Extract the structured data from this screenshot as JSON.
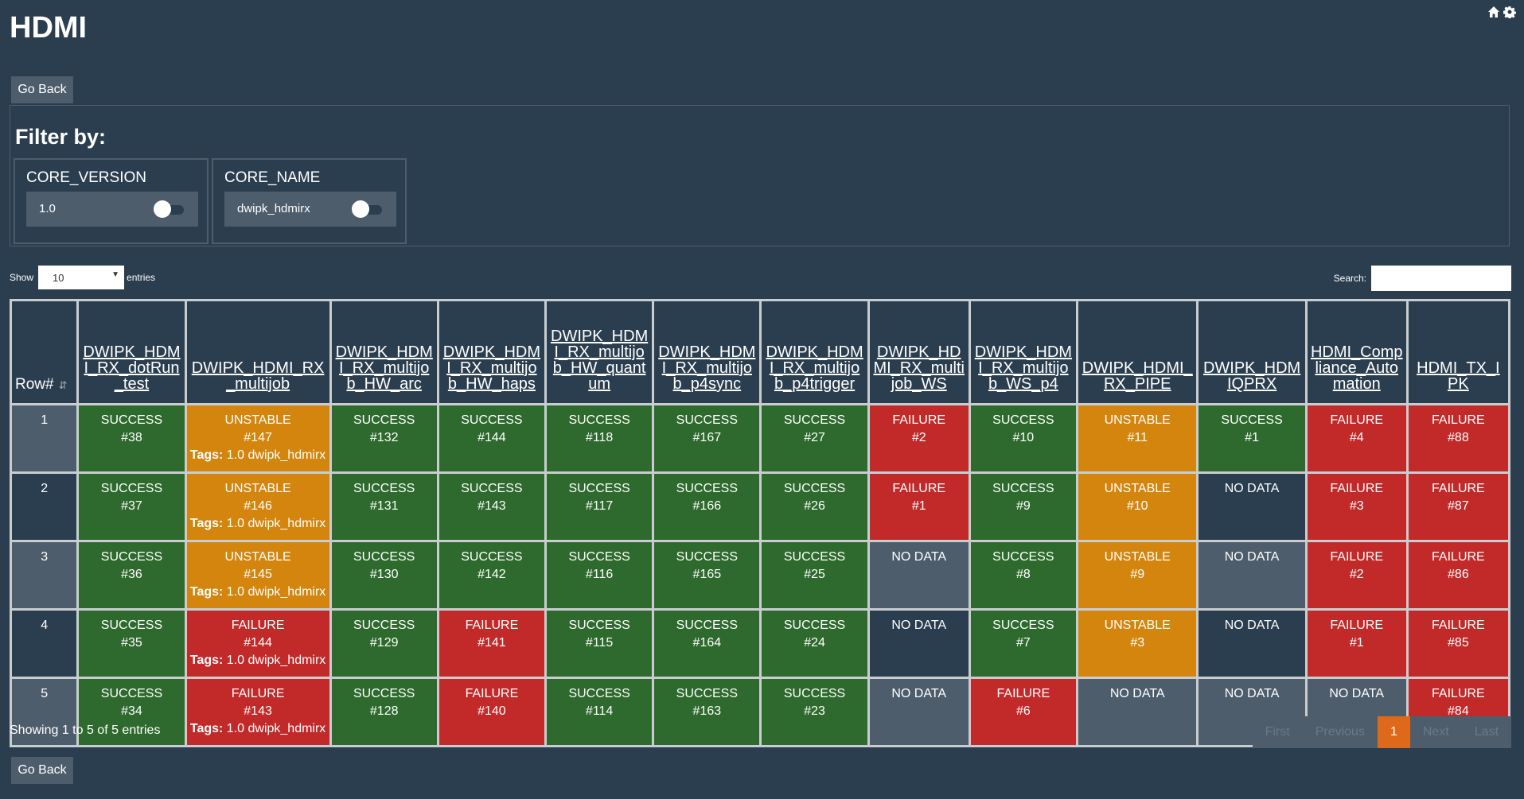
{
  "title": "HDMI",
  "go_back_label": "Go Back",
  "filter": {
    "title": "Filter by:",
    "cards": [
      {
        "label": "CORE_VERSION",
        "value": "1.0"
      },
      {
        "label": "CORE_NAME",
        "value": "dwipk_hdmirx"
      }
    ]
  },
  "show_label": "Show",
  "entries_label": "entries",
  "page_length": "10",
  "search_label": "Search:",
  "table": {
    "row_header": "Row#",
    "columns": [
      "DWIPK_HDMI_RX_dotRun_test",
      "DWIPK_HDMI_RX_multijob",
      "DWIPK_HDMI_RX_multijob_HW_arc",
      "DWIPK_HDMI_RX_multijob_HW_haps",
      "DWIPK_HDMI_RX_multijob_HW_quantum",
      "DWIPK_HDMI_RX_multijob_p4sync",
      "DWIPK_HDMI_RX_multijob_p4trigger",
      "DWIPK_HDMI_RX_multijob_WS",
      "DWIPK_HDMI_RX_multijob_WS_p4",
      "DWIPK_HDMI_RX_PIPE",
      "DWIPK_HDMIQPRX",
      "HDMI_Compliance_Automation",
      "HDMI_TX_IPK"
    ],
    "tags_label": "Tags:",
    "rows": [
      {
        "row": "1",
        "cells": [
          {
            "status": "SUCCESS",
            "build": "#38"
          },
          {
            "status": "UNSTABLE",
            "build": "#147",
            "tags": "1.0 dwipk_hdmirx"
          },
          {
            "status": "SUCCESS",
            "build": "#132"
          },
          {
            "status": "SUCCESS",
            "build": "#144"
          },
          {
            "status": "SUCCESS",
            "build": "#118"
          },
          {
            "status": "SUCCESS",
            "build": "#167"
          },
          {
            "status": "SUCCESS",
            "build": "#27"
          },
          {
            "status": "FAILURE",
            "build": "#2"
          },
          {
            "status": "SUCCESS",
            "build": "#10"
          },
          {
            "status": "UNSTABLE",
            "build": "#11"
          },
          {
            "status": "SUCCESS",
            "build": "#1"
          },
          {
            "status": "FAILURE",
            "build": "#4"
          },
          {
            "status": "FAILURE",
            "build": "#88"
          }
        ]
      },
      {
        "row": "2",
        "cells": [
          {
            "status": "SUCCESS",
            "build": "#37"
          },
          {
            "status": "UNSTABLE",
            "build": "#146",
            "tags": "1.0 dwipk_hdmirx"
          },
          {
            "status": "SUCCESS",
            "build": "#131"
          },
          {
            "status": "SUCCESS",
            "build": "#143"
          },
          {
            "status": "SUCCESS",
            "build": "#117"
          },
          {
            "status": "SUCCESS",
            "build": "#166"
          },
          {
            "status": "SUCCESS",
            "build": "#26"
          },
          {
            "status": "FAILURE",
            "build": "#1"
          },
          {
            "status": "SUCCESS",
            "build": "#9"
          },
          {
            "status": "UNSTABLE",
            "build": "#10"
          },
          {
            "status": "NO DATA"
          },
          {
            "status": "FAILURE",
            "build": "#3"
          },
          {
            "status": "FAILURE",
            "build": "#87"
          }
        ]
      },
      {
        "row": "3",
        "cells": [
          {
            "status": "SUCCESS",
            "build": "#36"
          },
          {
            "status": "UNSTABLE",
            "build": "#145",
            "tags": "1.0 dwipk_hdmirx"
          },
          {
            "status": "SUCCESS",
            "build": "#130"
          },
          {
            "status": "SUCCESS",
            "build": "#142"
          },
          {
            "status": "SUCCESS",
            "build": "#116"
          },
          {
            "status": "SUCCESS",
            "build": "#165"
          },
          {
            "status": "SUCCESS",
            "build": "#25"
          },
          {
            "status": "NO DATA"
          },
          {
            "status": "SUCCESS",
            "build": "#8"
          },
          {
            "status": "UNSTABLE",
            "build": "#9"
          },
          {
            "status": "NO DATA"
          },
          {
            "status": "FAILURE",
            "build": "#2"
          },
          {
            "status": "FAILURE",
            "build": "#86"
          }
        ]
      },
      {
        "row": "4",
        "cells": [
          {
            "status": "SUCCESS",
            "build": "#35"
          },
          {
            "status": "FAILURE",
            "build": "#144",
            "tags": "1.0 dwipk_hdmirx"
          },
          {
            "status": "SUCCESS",
            "build": "#129"
          },
          {
            "status": "FAILURE",
            "build": "#141"
          },
          {
            "status": "SUCCESS",
            "build": "#115"
          },
          {
            "status": "SUCCESS",
            "build": "#164"
          },
          {
            "status": "SUCCESS",
            "build": "#24"
          },
          {
            "status": "NO DATA"
          },
          {
            "status": "SUCCESS",
            "build": "#7"
          },
          {
            "status": "UNSTABLE",
            "build": "#3"
          },
          {
            "status": "NO DATA"
          },
          {
            "status": "FAILURE",
            "build": "#1"
          },
          {
            "status": "FAILURE",
            "build": "#85"
          }
        ]
      },
      {
        "row": "5",
        "cells": [
          {
            "status": "SUCCESS",
            "build": "#34"
          },
          {
            "status": "FAILURE",
            "build": "#143",
            "tags": "1.0 dwipk_hdmirx"
          },
          {
            "status": "SUCCESS",
            "build": "#128"
          },
          {
            "status": "FAILURE",
            "build": "#140"
          },
          {
            "status": "SUCCESS",
            "build": "#114"
          },
          {
            "status": "SUCCESS",
            "build": "#163"
          },
          {
            "status": "SUCCESS",
            "build": "#23"
          },
          {
            "status": "NO DATA"
          },
          {
            "status": "FAILURE",
            "build": "#6"
          },
          {
            "status": "NO DATA"
          },
          {
            "status": "NO DATA"
          },
          {
            "status": "NO DATA"
          },
          {
            "status": "FAILURE",
            "build": "#84"
          }
        ]
      }
    ]
  },
  "info_text": "Showing 1 to 5 of 5 entries",
  "pagination": {
    "first": "First",
    "previous": "Previous",
    "current": "1",
    "next": "Next",
    "last": "Last"
  },
  "colors": {
    "success": "#2e6a2e",
    "unstable": "#d4850e",
    "failure": "#c22a2a",
    "accent": "#df691a",
    "background": "#2b3e50"
  },
  "icons": [
    "home-icon",
    "gear-icon",
    "sort-icon"
  ]
}
